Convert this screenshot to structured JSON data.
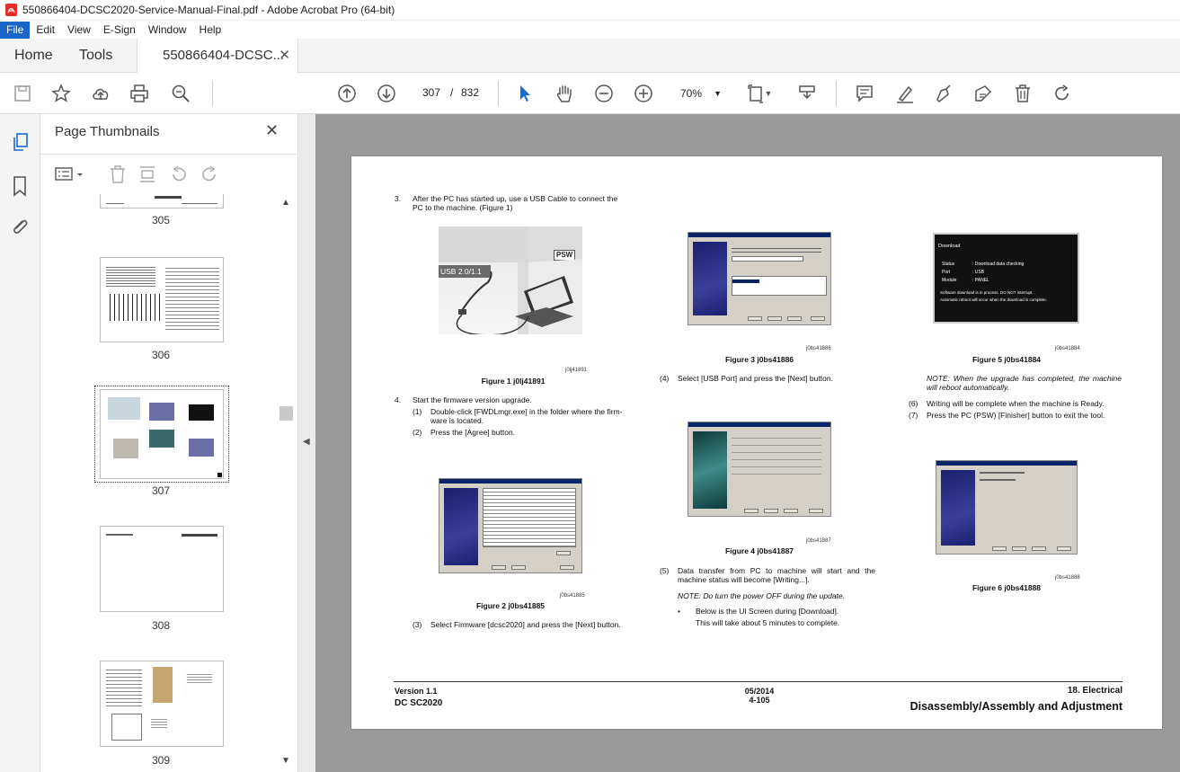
{
  "window": {
    "title": "550866404-DCSC2020-Service-Manual-Final.pdf - Adobe Acrobat Pro (64-bit)"
  },
  "menu": [
    "File",
    "Edit",
    "View",
    "E-Sign",
    "Window",
    "Help"
  ],
  "tabs": {
    "home": "Home",
    "tools": "Tools",
    "doc": "550866404-DCSC..."
  },
  "toolbar": {
    "page_current": "307",
    "page_sep": "/",
    "page_total": "832",
    "zoom": "70%"
  },
  "panel": {
    "title": "Page Thumbnails",
    "thumbs": [
      "305",
      "306",
      "307",
      "308",
      "309"
    ]
  },
  "page": {
    "step3": "3.",
    "step3_text1": "After the PC has started up, use a USB Cable to connect the",
    "step3_text2": "PC to the machine. (Figure 1)",
    "fig1_usb": "USB 2.0/1.1",
    "fig1_psw": "PSW",
    "fig1_id": "j0lj41891",
    "fig1_cap": "Figure 1 j0lj41891",
    "step4": "4.",
    "step4_text": "Start the firmware version upgrade.",
    "s1n": "(1)",
    "s1a": "Double-click [FWDLmgr.exe] in the folder where the firm-",
    "s1b": "ware is located.",
    "s2n": "(2)",
    "s2": "Press the [Agree] button.",
    "fig2_id": "j0bs41885",
    "fig2_cap": "Figure 2 j0bs41885",
    "s3n": "(3)",
    "s3": "Select Firmware [dcsc2020] and press the [Next] button.",
    "fig3_id": "j0bs41886",
    "fig3_cap": "Figure 3 j0bs41886",
    "s4n": "(4)",
    "s4": "Select [USB Port] and press the [Next] button.",
    "fig4_id": "j0bs41887",
    "fig4_cap": "Figure 4 j0bs41887",
    "s5n": "(5)",
    "s5a": "Data transfer from PC to machine will start and the",
    "s5b": "machine status will become [Writing...].",
    "note1": "NOTE:  Do turn the power OFF during the update.",
    "bullet": "•",
    "b1a": "Below is the UI Screen during [Download].",
    "b1b": "This will take about 5 minutes to complete.",
    "fig5_title": "Download",
    "fig5_status_k": "Status",
    "fig5_status_v": ": Download data checking",
    "fig5_port_k": "Port",
    "fig5_port_v": ": USB",
    "fig5_module_k": "Module",
    "fig5_module_v": ": PANEL",
    "fig5_msg1": "Software download is in process. DO NOT interrupt.",
    "fig5_msg2": "Automatic reboot will occur when the download is complete.",
    "fig5_id": "j0bs41884",
    "fig5_cap": "Figure 5 j0bs41884",
    "note2a": "NOTE: When the upgrade has completed, the machine",
    "note2b": "will reboot automatically.",
    "s6n": "(6)",
    "s6": "Writing will be complete when the machine is Ready.",
    "s7n": "(7)",
    "s7": "Press the PC (PSW) [Finisher] button to exit the tool.",
    "fig6_id": "j0bs41888",
    "fig6_cap": "Figure 6 j0bs41888",
    "footer_version": "Version 1.1",
    "footer_model": "DC SC2020",
    "footer_date": "05/2014",
    "footer_page": "4-105",
    "footer_section": "18. Electrical",
    "footer_title": "Disassembly/Assembly and Adjustment"
  }
}
